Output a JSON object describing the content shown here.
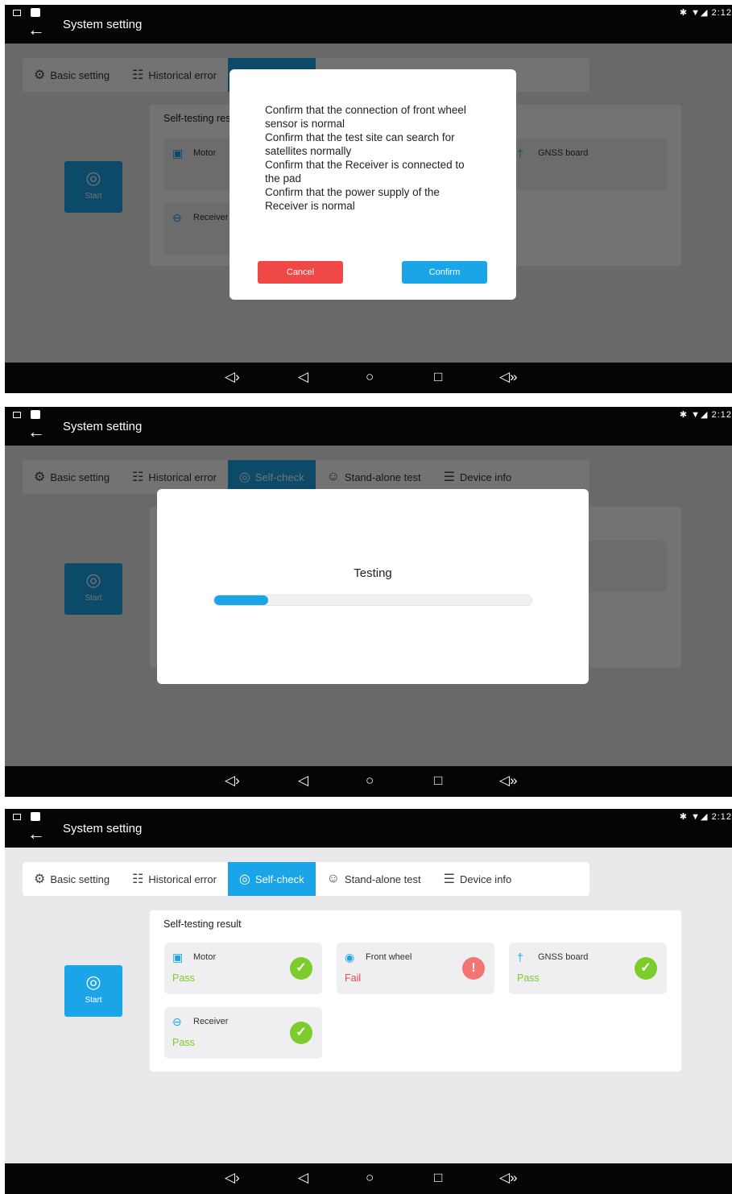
{
  "app": {
    "title": "System setting",
    "status_time": "2:12",
    "status_icons": "✱ ▼◢"
  },
  "tabs": [
    {
      "label": "Basic setting",
      "icon": "gear-icon",
      "glyph": "⚙"
    },
    {
      "label": "Historical error",
      "icon": "calendar-error-icon",
      "glyph": "☷"
    },
    {
      "label": "Self-check",
      "icon": "shield-check-icon",
      "glyph": "◎"
    },
    {
      "label": "Stand-alone test",
      "icon": "person-icon",
      "glyph": "☺"
    },
    {
      "label": "Device info",
      "icon": "list-icon",
      "glyph": "☰"
    }
  ],
  "start_button": {
    "label": "Start",
    "icon": "target-icon",
    "glyph": "◎"
  },
  "results": {
    "title": "Self-testing result",
    "items": [
      {
        "name": "Motor",
        "status": "Pass",
        "icon": "motor-icon",
        "glyph": "▣",
        "result": "pass"
      },
      {
        "name": "Front wheel",
        "status": "Fail",
        "icon": "wheel-icon",
        "glyph": "◉",
        "result": "fail"
      },
      {
        "name": "GNSS board",
        "status": "Pass",
        "icon": "antenna-icon",
        "glyph": "†",
        "result": "pass"
      },
      {
        "name": "Receiver",
        "status": "Pass",
        "icon": "receiver-icon",
        "glyph": "⊖",
        "result": "pass"
      }
    ]
  },
  "confirm_dialog": {
    "lines": [
      "Confirm that the connection of front wheel sensor is normal",
      " Confirm that the test site can search for satellites normally",
      " Confirm that the Receiver is connected to the pad",
      " Confirm that the power supply of the Receiver is normal"
    ],
    "cancel_label": "Cancel",
    "confirm_label": "Confirm"
  },
  "testing_dialog": {
    "label": "Testing",
    "progress": 0.17
  },
  "navbar": {
    "vol_down": "◁›",
    "back": "◁",
    "home": "○",
    "recent": "□",
    "vol_up": "◁»"
  },
  "colors": {
    "accent": "#1aa5e8",
    "pass": "#7ccd2c",
    "fail": "#f04747"
  }
}
